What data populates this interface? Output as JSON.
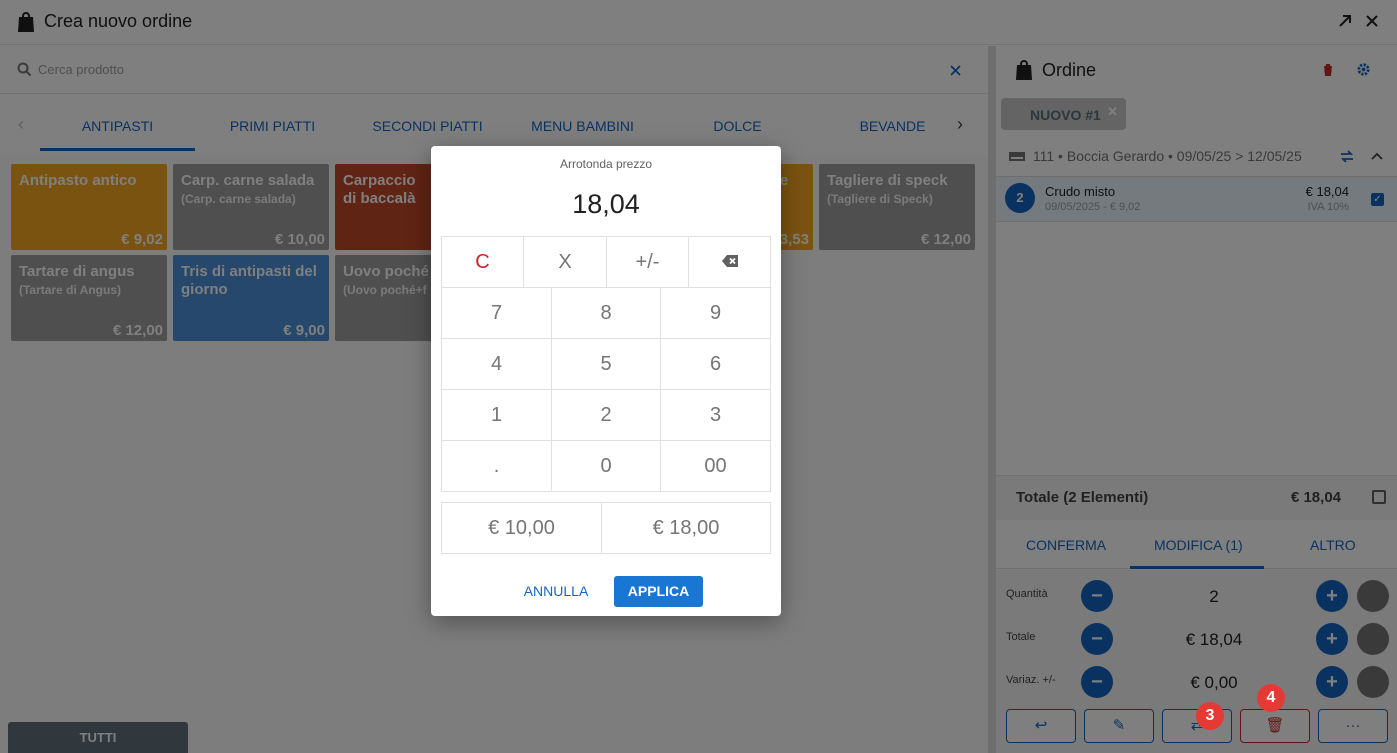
{
  "window": {
    "title": "Crea nuovo ordine"
  },
  "search": {
    "placeholder": "Cerca prodotto"
  },
  "categories": [
    "ANTIPASTI",
    "PRIMI PIATTI",
    "SECONDI PIATTI",
    "MENU BAMBINI",
    "DOLCE",
    "BEVANDE"
  ],
  "products": [
    {
      "name": "Antipasto antico",
      "sub": "",
      "price": "€ 9,02"
    },
    {
      "name": "Carp. carne salada",
      "sub": "(Carp. carne salada)",
      "price": "€ 10,00"
    },
    {
      "name": "Carpaccio di baccalà",
      "sub": "",
      "price": ""
    },
    {
      "name": "e",
      "sub": "",
      "price": "3,53"
    },
    {
      "name": "Tagliere di speck",
      "sub": "(Tagliere di Speck)",
      "price": "€ 12,00"
    },
    {
      "name": "Tartare di angus",
      "sub": "(Tartare di Angus)",
      "price": "€ 12,00"
    },
    {
      "name": "Tris di antipasti del giorno",
      "sub": "",
      "price": "€ 9,00"
    },
    {
      "name": "Uovo poché",
      "sub": "(Uovo poché+f",
      "price": ""
    }
  ],
  "bottom_left": {
    "all_label": "TUTTI"
  },
  "order": {
    "title": "Ordine",
    "chip": "NUOVO #1",
    "guest_line": "111 • Boccia Gerardo • 09/05/25 > 12/05/25",
    "item": {
      "qty": "2",
      "name": "Crudo misto",
      "detail": "09/05/2025 - € 9,02",
      "price": "€ 18,04",
      "vat": "IVA 10%"
    },
    "total_label": "Totale (2 Elementi)",
    "total_value": "€ 18,04",
    "tabs": [
      "CONFERMA",
      "MODIFICA (1)",
      "ALTRO"
    ],
    "fields": [
      {
        "label": "Quantità",
        "value": "2"
      },
      {
        "label": "Totale",
        "value": "€ 18,04"
      },
      {
        "label": "Variaz. +/-",
        "value": "€ 0,00"
      }
    ],
    "actions_more": "···"
  },
  "dialog": {
    "title": "Arrotonda prezzo",
    "value": "18,04",
    "top_keys": [
      "C",
      "X",
      "+/-"
    ],
    "digits": [
      "7",
      "8",
      "9",
      "4",
      "5",
      "6",
      "1",
      "2",
      "3",
      ".",
      "0",
      "00"
    ],
    "presets": [
      "€ 10,00",
      "€ 18,00"
    ],
    "cancel": "ANNULLA",
    "apply": "APPLICA"
  },
  "badges": [
    "3",
    "4"
  ],
  "colors": {
    "primary": "#1565c0",
    "danger": "#e53935",
    "orange": "#f5a623",
    "grey": "#9e9e9e",
    "red": "#c0492a",
    "blue": "#4a90d9"
  }
}
